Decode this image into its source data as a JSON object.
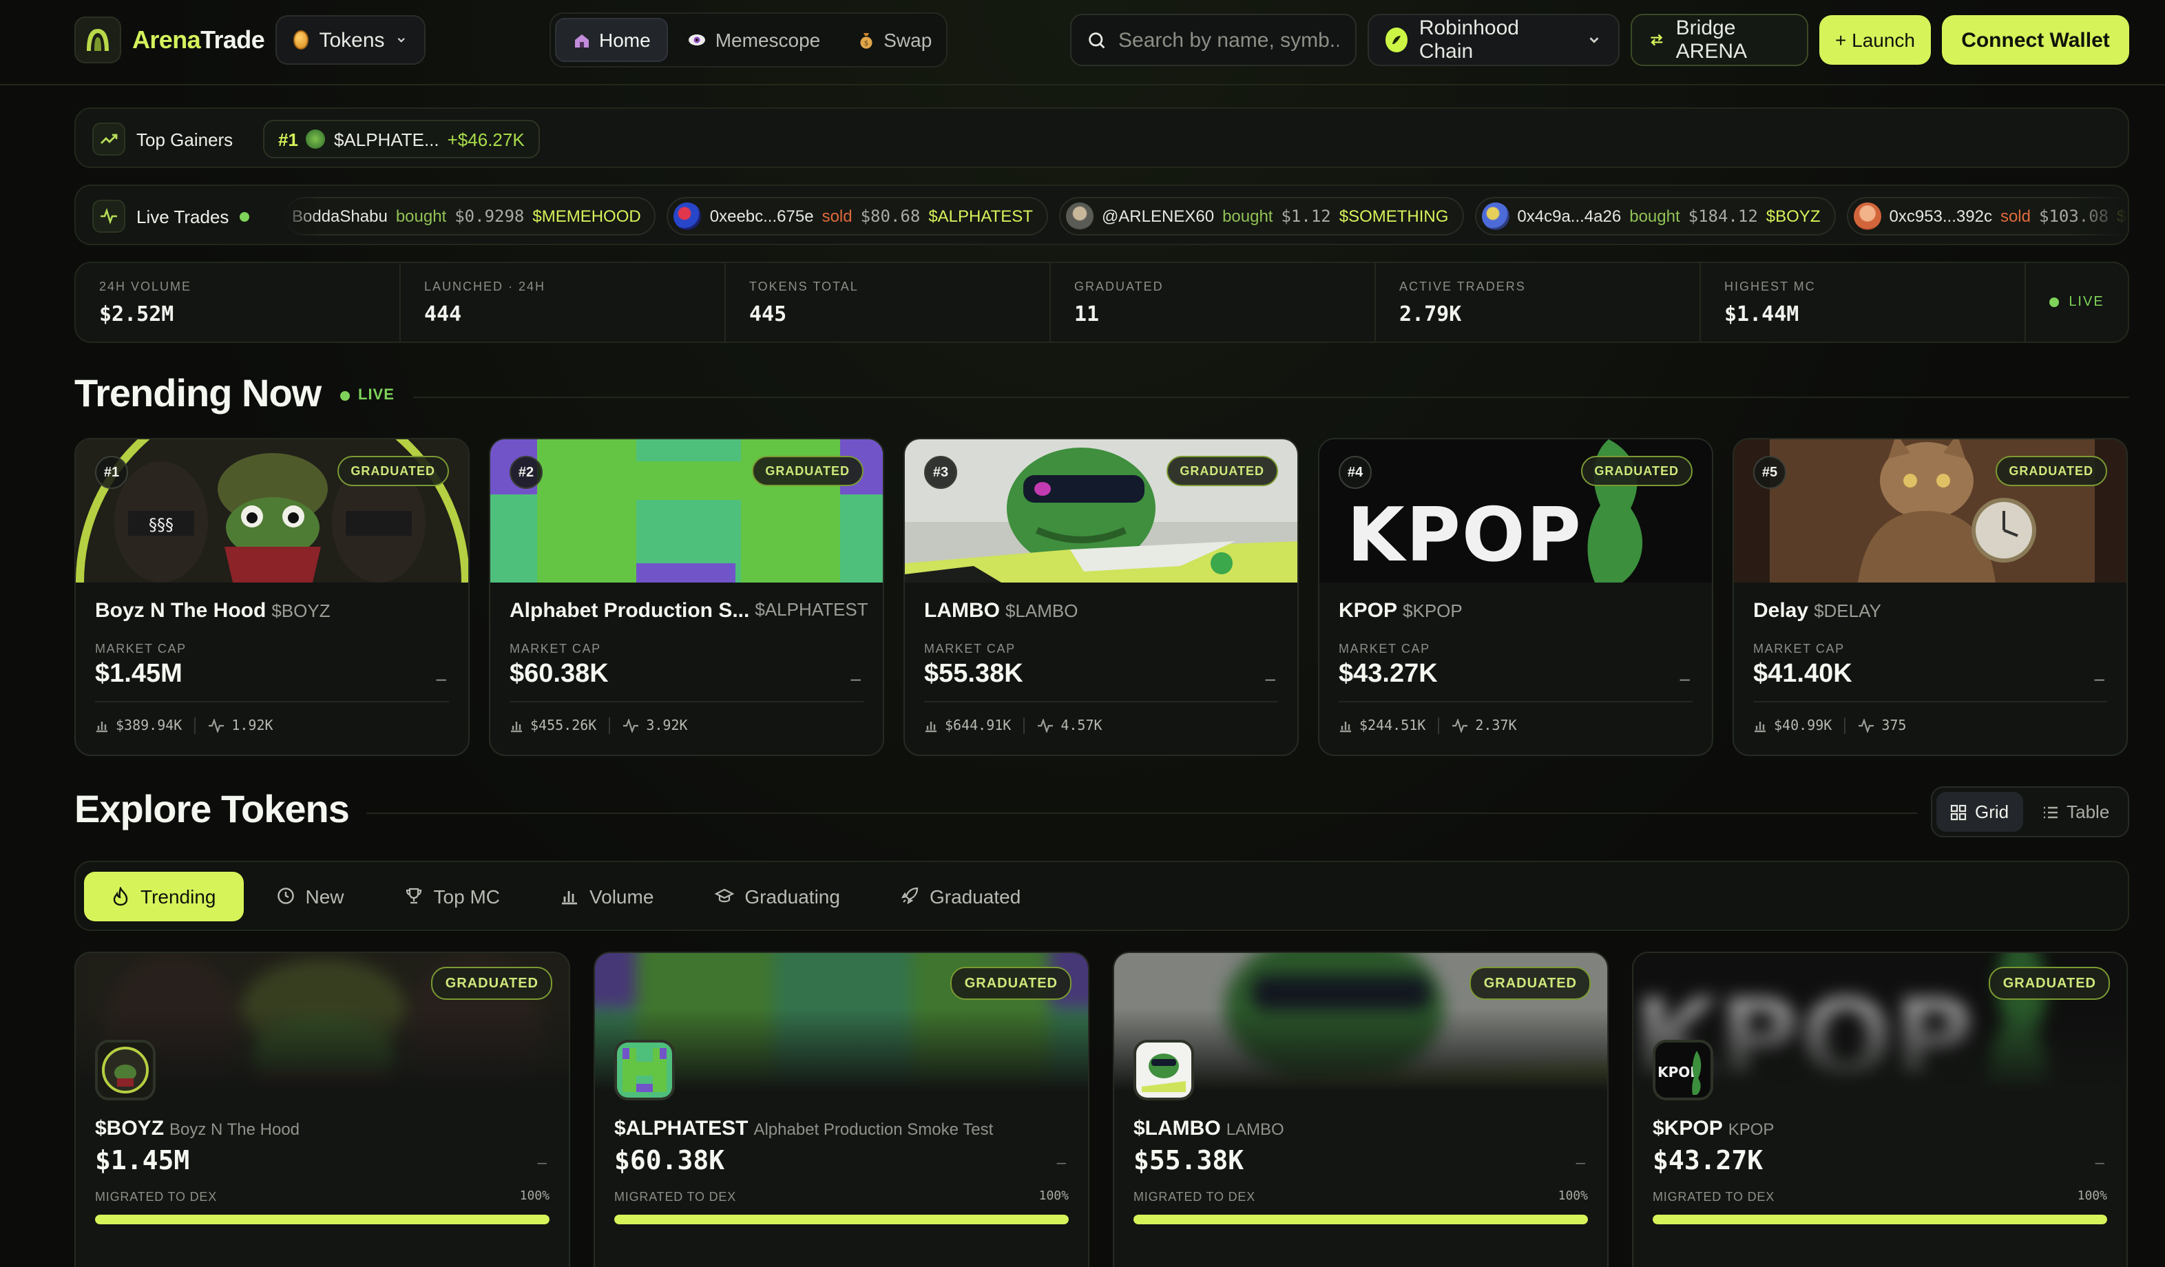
{
  "header": {
    "brand_a": "Arena",
    "brand_b": "Trade",
    "tokens_label": "Tokens",
    "nav": [
      {
        "label": "Home",
        "icon": "home-icon"
      },
      {
        "label": "Memescope",
        "icon": "eye-icon"
      },
      {
        "label": "Swap",
        "icon": "money-bag-icon"
      }
    ],
    "search_placeholder": "Search by name, symb...",
    "chain_label": "Robinhood Chain",
    "bridge_label": "Bridge ARENA",
    "launch_label": "+ Launch",
    "connect_label": "Connect Wallet",
    "accent": "#d6f35a"
  },
  "gainers": {
    "label": "Top Gainers",
    "items": [
      {
        "rank": "#1",
        "symbol": "$ALPHATE...",
        "gain": "+$46.27K"
      }
    ]
  },
  "trades": {
    "label": "Live Trades",
    "items": [
      {
        "user": "BoddaShabu",
        "action": "bought",
        "amount": "$0.9298",
        "token": "$MEMEHOOD"
      },
      {
        "user": "0xeebc...675e",
        "action": "sold",
        "amount": "$80.68",
        "token": "$ALPHATEST"
      },
      {
        "user": "@ARLENEX60",
        "action": "bought",
        "amount": "$1.12",
        "token": "$SOMETHING"
      },
      {
        "user": "0x4c9a...4a26",
        "action": "bought",
        "amount": "$184.12",
        "token": "$BOYZ"
      },
      {
        "user": "0xc953...392c",
        "action": "sold",
        "amount": "$103.08",
        "token": "$KPOP"
      }
    ]
  },
  "stats": [
    {
      "label": "24H VOLUME",
      "value": "$2.52M"
    },
    {
      "label": "LAUNCHED · 24H",
      "value": "444"
    },
    {
      "label": "TOKENS TOTAL",
      "value": "445"
    },
    {
      "label": "GRADUATED",
      "value": "11"
    },
    {
      "label": "ACTIVE TRADERS",
      "value": "2.79K"
    },
    {
      "label": "HIGHEST MC",
      "value": "$1.44M"
    }
  ],
  "stats_live": "LIVE",
  "trending": {
    "title": "Trending Now",
    "live": "LIVE",
    "badge": "GRADUATED",
    "mc_label": "MARKET CAP",
    "dash": "–",
    "cards": [
      {
        "rank": "#1",
        "name": "Boyz N The Hood",
        "symbol": "$BOYZ",
        "mc": "$1.45M",
        "volume": "$389.94K",
        "trades": "1.92K"
      },
      {
        "rank": "#2",
        "name": "Alphabet Production S...",
        "symbol": "$ALPHATEST",
        "mc": "$60.38K",
        "volume": "$455.26K",
        "trades": "3.92K"
      },
      {
        "rank": "#3",
        "name": "LAMBO",
        "symbol": "$LAMBO",
        "mc": "$55.38K",
        "volume": "$644.91K",
        "trades": "4.57K"
      },
      {
        "rank": "#4",
        "name": "KPOP",
        "symbol": "$KPOP",
        "mc": "$43.27K",
        "volume": "$244.51K",
        "trades": "2.37K"
      },
      {
        "rank": "#5",
        "name": "Delay",
        "symbol": "$DELAY",
        "mc": "$41.40K",
        "volume": "$40.99K",
        "trades": "375"
      }
    ]
  },
  "explore": {
    "title": "Explore Tokens",
    "view_grid": "Grid",
    "view_table": "Table",
    "filters": [
      {
        "label": "Trending",
        "icon": "flame-icon"
      },
      {
        "label": "New",
        "icon": "clock-icon"
      },
      {
        "label": "Top MC",
        "icon": "trophy-icon"
      },
      {
        "label": "Volume",
        "icon": "bar-chart-icon"
      },
      {
        "label": "Graduating",
        "icon": "graduation-cap-icon"
      },
      {
        "label": "Graduated",
        "icon": "rocket-icon"
      }
    ],
    "badge": "GRADUATED",
    "migrated_label": "MIGRATED TO DEX",
    "dash": "–",
    "cards": [
      {
        "symbol": "$BOYZ",
        "name": "Boyz N The Hood",
        "mc": "$1.45M",
        "progress": "100%"
      },
      {
        "symbol": "$ALPHATEST",
        "name": "Alphabet Production Smoke Test",
        "mc": "$60.38K",
        "progress": "100%"
      },
      {
        "symbol": "$LAMBO",
        "name": "LAMBO",
        "mc": "$55.38K",
        "progress": "100%"
      },
      {
        "symbol": "$KPOP",
        "name": "KPOP",
        "mc": "$43.27K",
        "progress": "100%"
      }
    ]
  }
}
